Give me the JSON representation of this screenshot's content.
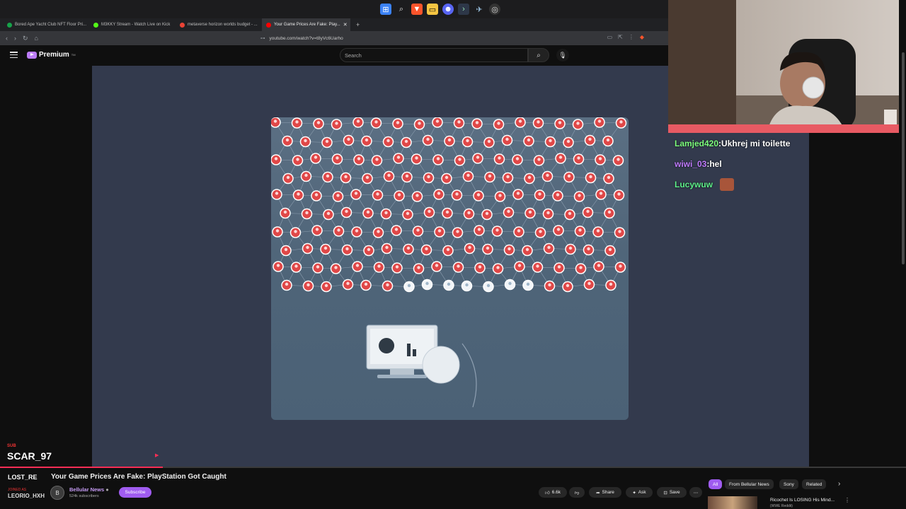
{
  "taskbar": {
    "icons": [
      "windows-icon",
      "search-icon",
      "brave-icon",
      "folder-icon",
      "discord-icon",
      "terminal-icon",
      "steam-icon",
      "obs-icon"
    ]
  },
  "browser": {
    "tabs": [
      {
        "label": "Bored Ape Yacht Club NFT Floor Pri...",
        "color": "#16a34a"
      },
      {
        "label": "M3KKY Stream - Watch Live on Kick",
        "color": "#53fc18"
      },
      {
        "label": "metaverse horizon worlds budget - ...",
        "color": "#ea4335"
      },
      {
        "label": "Your Game Prices Are Fake: Play...",
        "color": "#ff0000"
      }
    ],
    "url": "youtube.com/watch?v=t8yVc6Uarho"
  },
  "youtube": {
    "logo_text": "Premium",
    "logo_sup": "TM",
    "search_placeholder": "Search"
  },
  "chat": [
    {
      "user": "Lamjed420",
      "message": ":Ukhrej mi toilette",
      "color": "#7dff7d"
    },
    {
      "user": "wiwi_03",
      "message": ":hel",
      "color": "#c17cff"
    },
    {
      "user": "Lucywuw",
      "message": "",
      "color": "#5ef08a"
    }
  ],
  "overlay": {
    "sub_tag": "SUB",
    "sub_name": "SCAR_97",
    "lost": "LOST_RE",
    "leo_tag": "JOINED AS",
    "leo": "LEORIO_HXH"
  },
  "video": {
    "title": "Your Game Prices Are Fake: PlayStation Got Caught",
    "channel": "Bellular News",
    "subscribers": "524k subscribers",
    "subscribe_label": "Subscribe",
    "likes": "6.6k",
    "share_label": "Share",
    "ask_label": "Ask",
    "save_label": "Save",
    "progress_fraction": 0.18
  },
  "chips": [
    "All",
    "From Bellular News",
    "Sony",
    "Related"
  ],
  "recommendation": {
    "title": "Ricochet Is LOSING His Mind...",
    "subtitle": "(WWE Reddit)"
  },
  "colors": {
    "accent": "#a05cf0",
    "player_bg": "#333a4d",
    "node_red": "#e04848",
    "node_white": "#f2f5f8"
  }
}
